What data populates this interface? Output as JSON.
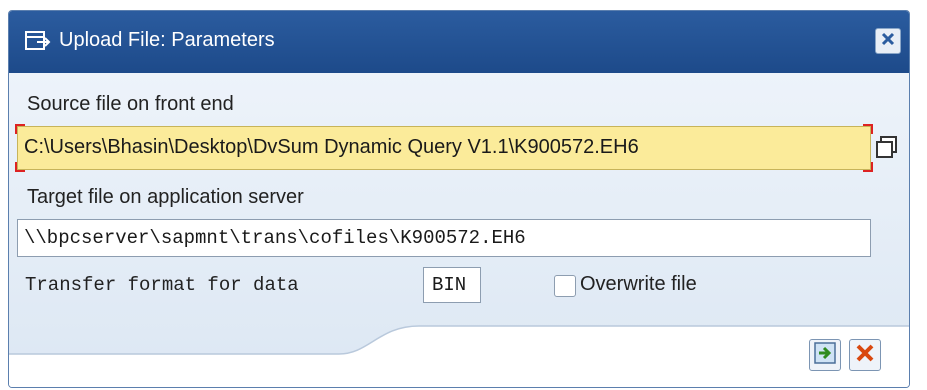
{
  "window": {
    "title": "Upload File: Parameters",
    "title_icon": "dialog-window-icon",
    "close_icon": "close-icon"
  },
  "form": {
    "source_label": "Source file on front end",
    "source_value": "C:\\Users\\Bhasin\\Desktop\\DvSum Dynamic Query V1.1\\K900572.EH6",
    "value_help_icon": "value-help-icon",
    "target_label": "Target file on application server",
    "target_value": "\\\\bpcserver\\sapmnt\\trans\\cofiles\\K900572.EH6",
    "format_label": "Transfer format for data",
    "format_value": "BIN",
    "overwrite_label": "Overwrite file",
    "overwrite_checked": false
  },
  "actions": {
    "ok_icon": "transfer-check-icon",
    "cancel_icon": "cancel-icon"
  },
  "colors": {
    "titlebar": "#1d4a8a",
    "required_field": "#fbeb9a",
    "body_bg": "#dce7f3"
  }
}
